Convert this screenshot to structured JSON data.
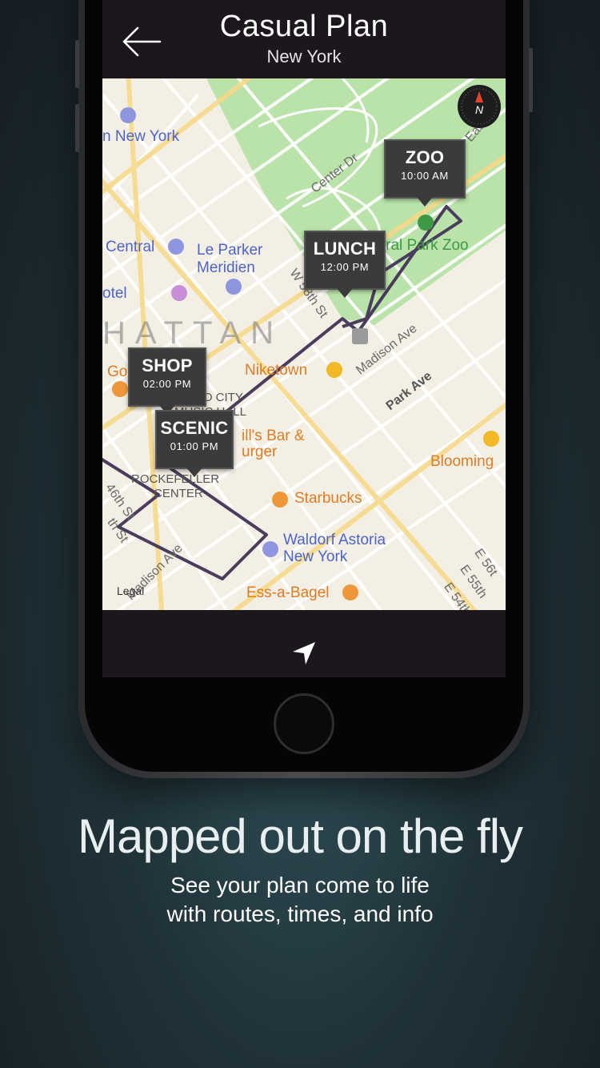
{
  "nav": {
    "title": "Casual Plan",
    "subtitle": "New York",
    "back_icon": "arrow-left-icon"
  },
  "map": {
    "district_label": "HATTAN",
    "legal": "Legal",
    "poi_labels": {
      "hotel_new_york": "n New York",
      "central": "Central",
      "le_parker_1": "Le Parker",
      "le_parker_2": "Meridien",
      "otel": "otel",
      "niketown": "Niketown",
      "radio_city_1": "RADIO CITY",
      "radio_city_2": "MUSIC HALL",
      "bar_1": "ill's Bar &",
      "bar_2": "urger",
      "rockefeller_1": "ROCKEFELLER",
      "rockefeller_2": "CENTER",
      "starbucks": "Starbucks",
      "waldorf_1": "Waldorf Astoria",
      "waldorf_2": "New York",
      "ess_a_bagel": "Ess-a-Bagel",
      "blooming": "Blooming",
      "central_park_zoo": "Central Park Zoo",
      "gor": "Gor"
    },
    "street_labels": {
      "center_dr": "Center Dr",
      "east_dr": "East Dr",
      "w58": "W 58th St",
      "madison_1": "Madison Ave",
      "park_ave": "Park Ave",
      "w46": "46th St",
      "st": "th St",
      "madison_2": "Madison Ave",
      "e56": "E 56t",
      "e55": "E 55th",
      "e54": "E 54th"
    },
    "pins": [
      {
        "name": "ZOO",
        "time": "10:00 AM"
      },
      {
        "name": "LUNCH",
        "time": "12:00 PM"
      },
      {
        "name": "SHOP",
        "time": "02:00 PM"
      },
      {
        "name": "SCENIC",
        "time": "01:00 PM"
      }
    ],
    "compass_label": "N",
    "colors": {
      "route": "#4a3c5c",
      "park": "#b9e3a8",
      "land": "#f4efe4",
      "major_road": "#f7d98a",
      "minor_road": "#ffffff"
    }
  },
  "toolbar": {
    "locate_icon": "location-arrow-icon"
  },
  "promo": {
    "headline": "Mapped out on the fly",
    "line1": "See your plan come to life",
    "line2": "with routes, times, and info"
  }
}
